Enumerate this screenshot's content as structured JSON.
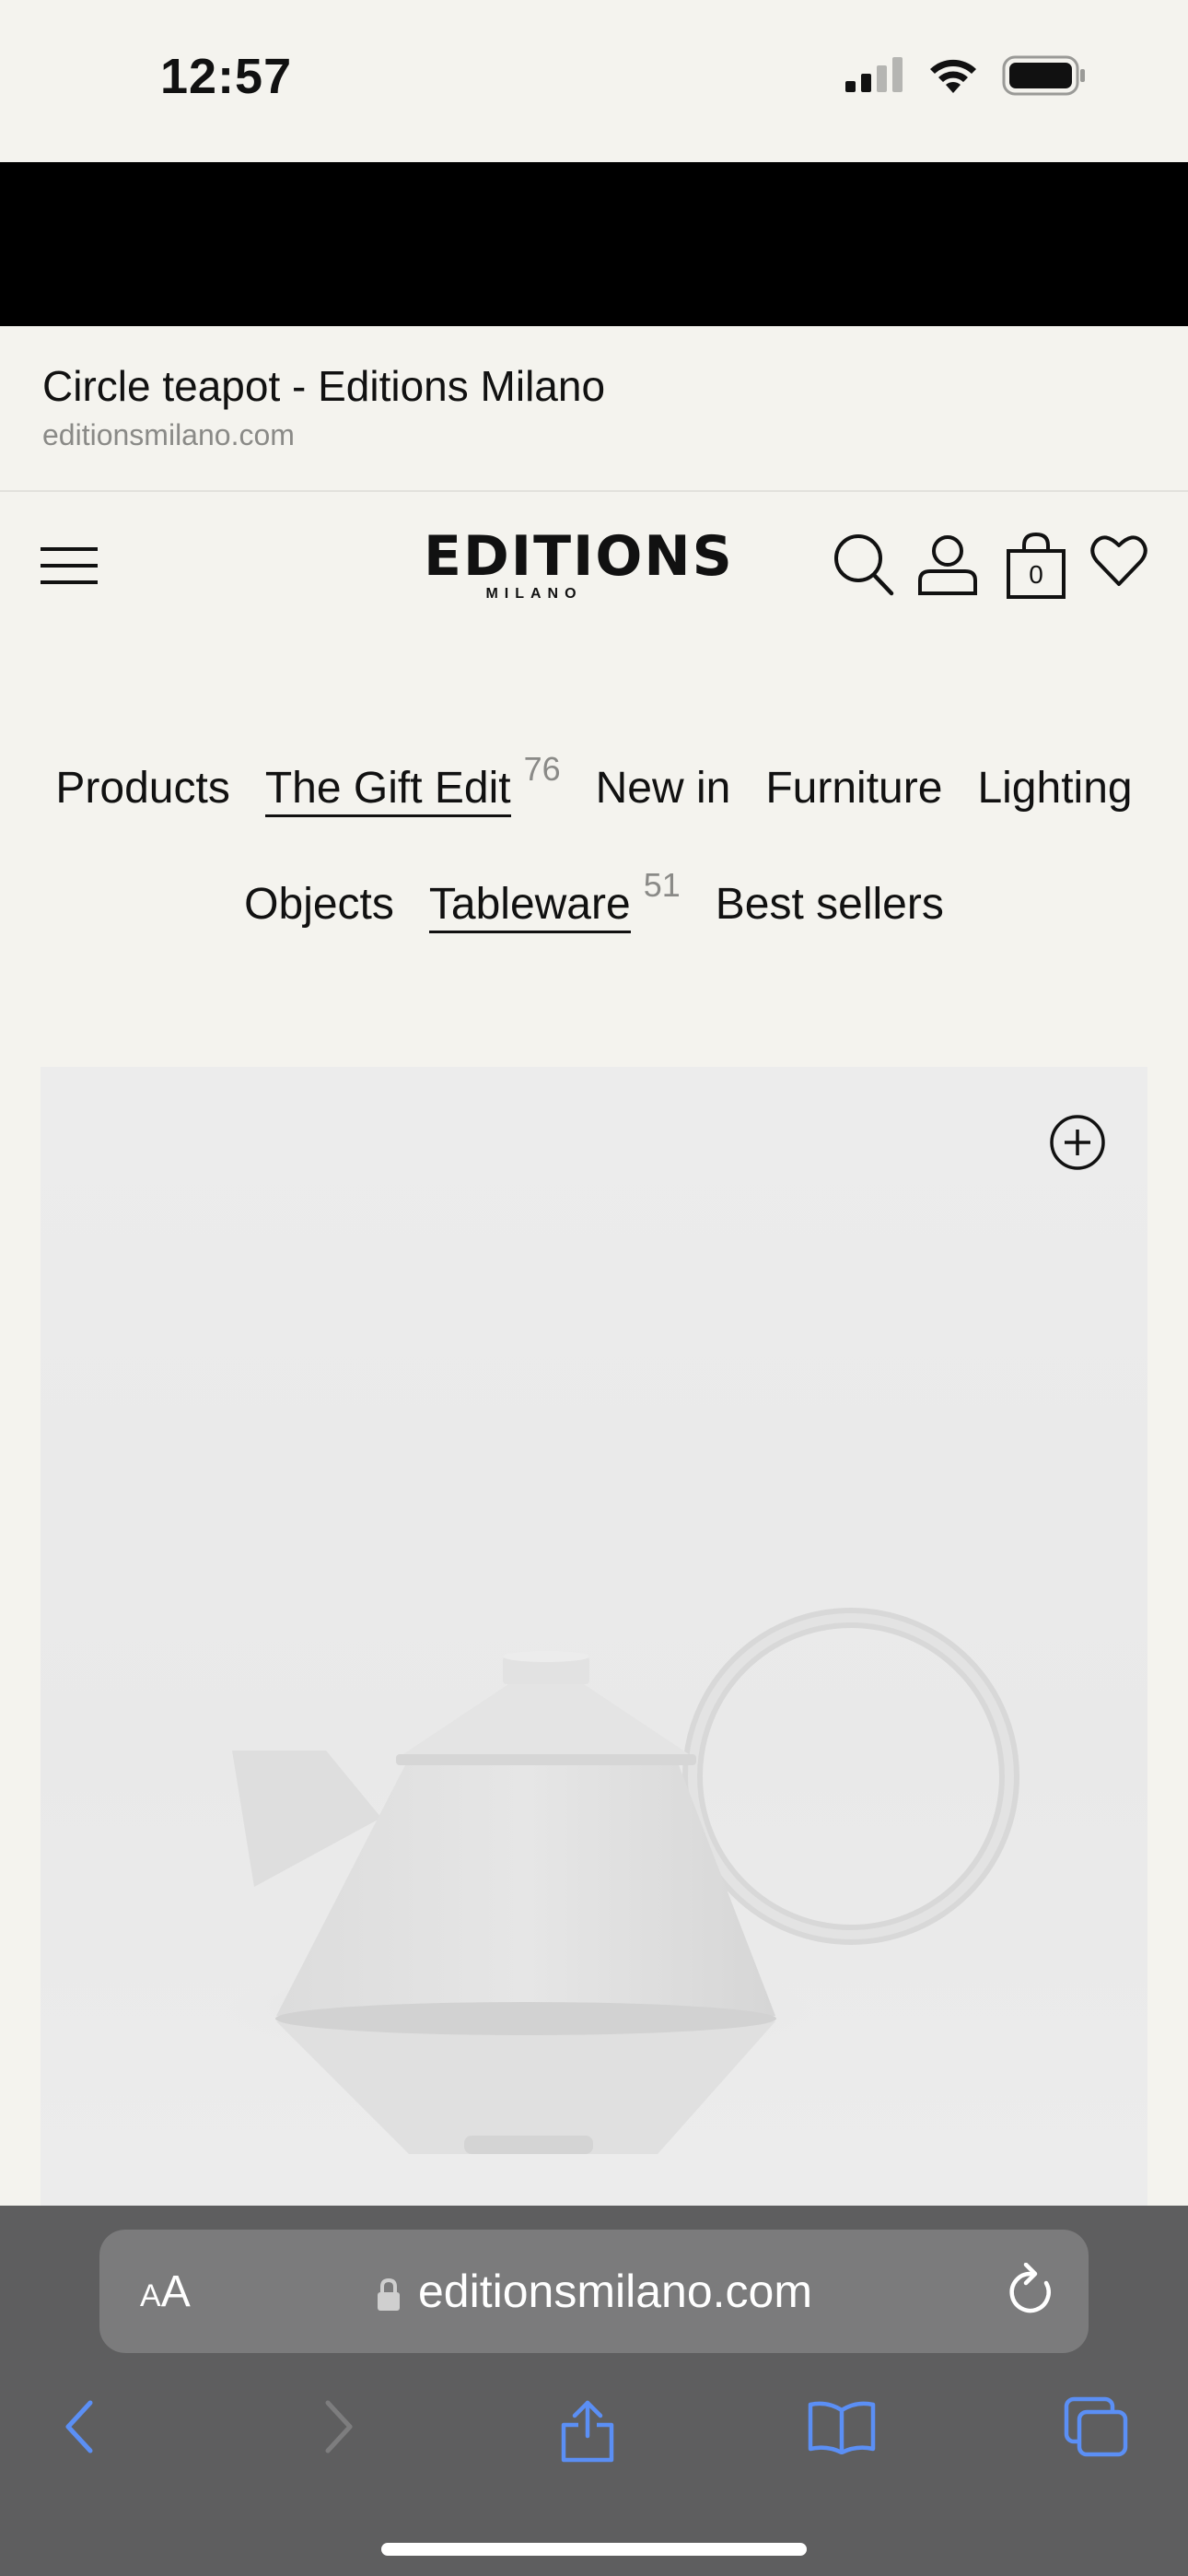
{
  "status_bar": {
    "time": "12:57"
  },
  "page_info": {
    "title": "Circle teapot - Editions Milano",
    "domain": "editionsmilano.com"
  },
  "site_header": {
    "logo_main": "EDITIONS",
    "logo_sub": "MILANO",
    "cart_count": "0"
  },
  "categories": {
    "row1": [
      {
        "label": "Products",
        "count": ""
      },
      {
        "label": "The Gift Edit",
        "count": "76"
      },
      {
        "label": "New in",
        "count": ""
      },
      {
        "label": "Furniture",
        "count": ""
      },
      {
        "label": "Lighting",
        "count": ""
      }
    ],
    "row2": [
      {
        "label": "Objects",
        "count": ""
      },
      {
        "label": "Tableware",
        "count": "51"
      },
      {
        "label": "Best sellers",
        "count": ""
      }
    ]
  },
  "safari": {
    "aa_small": "A",
    "aa_large": "A",
    "url": "editionsmilano.com"
  },
  "colors": {
    "background": "#f4f3ee",
    "banner": "#000000",
    "safari_bar": "#5e5e5f",
    "toolbar_accent": "#5b8ff5"
  }
}
